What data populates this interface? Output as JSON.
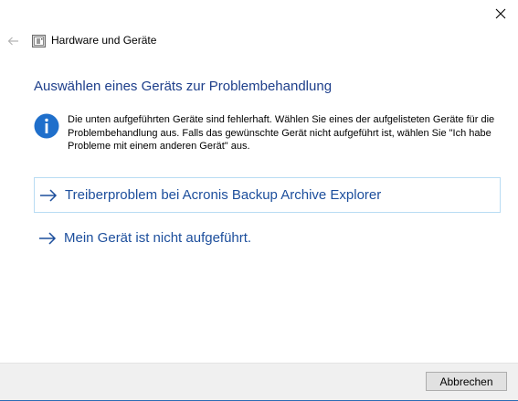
{
  "window": {
    "close_icon": "close-icon"
  },
  "titlebar": {
    "back_icon": "back-arrow-icon",
    "app_icon": "hardware-device-icon",
    "title": "Hardware und Geräte"
  },
  "main": {
    "heading": "Auswählen eines Geräts zur Problembehandlung",
    "info_icon": "info-icon",
    "info_text": "Die unten aufgeführten Geräte sind fehlerhaft. Wählen Sie eines der aufgelisteten Geräte für die Problembehandlung aus. Falls das gewünschte Gerät nicht aufgeführt ist, wählen Sie \"Ich habe Probleme mit einem anderen Gerät\" aus.",
    "options": [
      {
        "label": "Treiberproblem bei Acronis Backup Archive Explorer",
        "icon": "arrow-right-icon",
        "selected": true
      },
      {
        "label": "Mein Gerät ist nicht aufgeführt.",
        "icon": "arrow-right-icon",
        "selected": false
      }
    ]
  },
  "footer": {
    "cancel_label": "Abbrechen"
  },
  "colors": {
    "heading": "#1e3f8b",
    "link": "#1c4e9c",
    "info_icon_bg": "#1f6fcb",
    "selected_border": "#b9dcf3",
    "footer_bg": "#f0f0f0"
  }
}
